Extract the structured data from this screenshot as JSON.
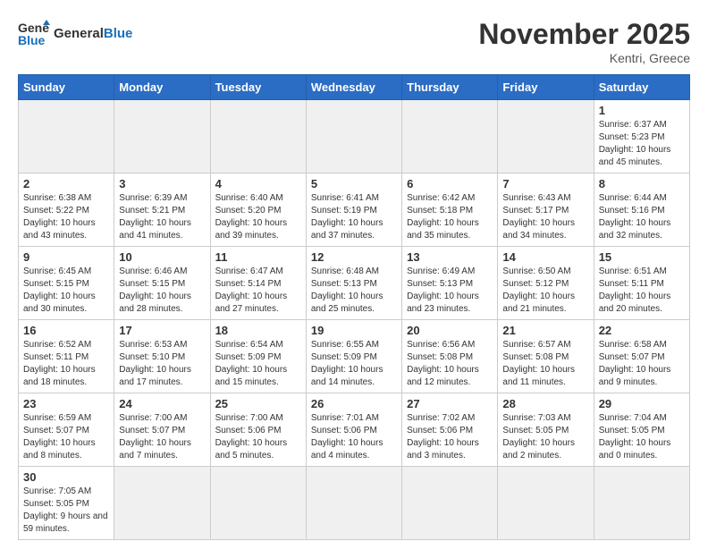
{
  "header": {
    "logo_general": "General",
    "logo_blue": "Blue",
    "month_title": "November 2025",
    "subtitle": "Kentri, Greece"
  },
  "weekdays": [
    "Sunday",
    "Monday",
    "Tuesday",
    "Wednesday",
    "Thursday",
    "Friday",
    "Saturday"
  ],
  "weeks": [
    [
      {
        "day": "",
        "content": ""
      },
      {
        "day": "",
        "content": ""
      },
      {
        "day": "",
        "content": ""
      },
      {
        "day": "",
        "content": ""
      },
      {
        "day": "",
        "content": ""
      },
      {
        "day": "",
        "content": ""
      },
      {
        "day": "1",
        "content": "Sunrise: 6:37 AM\nSunset: 5:23 PM\nDaylight: 10 hours and 45 minutes."
      }
    ],
    [
      {
        "day": "2",
        "content": "Sunrise: 6:38 AM\nSunset: 5:22 PM\nDaylight: 10 hours and 43 minutes."
      },
      {
        "day": "3",
        "content": "Sunrise: 6:39 AM\nSunset: 5:21 PM\nDaylight: 10 hours and 41 minutes."
      },
      {
        "day": "4",
        "content": "Sunrise: 6:40 AM\nSunset: 5:20 PM\nDaylight: 10 hours and 39 minutes."
      },
      {
        "day": "5",
        "content": "Sunrise: 6:41 AM\nSunset: 5:19 PM\nDaylight: 10 hours and 37 minutes."
      },
      {
        "day": "6",
        "content": "Sunrise: 6:42 AM\nSunset: 5:18 PM\nDaylight: 10 hours and 35 minutes."
      },
      {
        "day": "7",
        "content": "Sunrise: 6:43 AM\nSunset: 5:17 PM\nDaylight: 10 hours and 34 minutes."
      },
      {
        "day": "8",
        "content": "Sunrise: 6:44 AM\nSunset: 5:16 PM\nDaylight: 10 hours and 32 minutes."
      }
    ],
    [
      {
        "day": "9",
        "content": "Sunrise: 6:45 AM\nSunset: 5:15 PM\nDaylight: 10 hours and 30 minutes."
      },
      {
        "day": "10",
        "content": "Sunrise: 6:46 AM\nSunset: 5:15 PM\nDaylight: 10 hours and 28 minutes."
      },
      {
        "day": "11",
        "content": "Sunrise: 6:47 AM\nSunset: 5:14 PM\nDaylight: 10 hours and 27 minutes."
      },
      {
        "day": "12",
        "content": "Sunrise: 6:48 AM\nSunset: 5:13 PM\nDaylight: 10 hours and 25 minutes."
      },
      {
        "day": "13",
        "content": "Sunrise: 6:49 AM\nSunset: 5:13 PM\nDaylight: 10 hours and 23 minutes."
      },
      {
        "day": "14",
        "content": "Sunrise: 6:50 AM\nSunset: 5:12 PM\nDaylight: 10 hours and 21 minutes."
      },
      {
        "day": "15",
        "content": "Sunrise: 6:51 AM\nSunset: 5:11 PM\nDaylight: 10 hours and 20 minutes."
      }
    ],
    [
      {
        "day": "16",
        "content": "Sunrise: 6:52 AM\nSunset: 5:11 PM\nDaylight: 10 hours and 18 minutes."
      },
      {
        "day": "17",
        "content": "Sunrise: 6:53 AM\nSunset: 5:10 PM\nDaylight: 10 hours and 17 minutes."
      },
      {
        "day": "18",
        "content": "Sunrise: 6:54 AM\nSunset: 5:09 PM\nDaylight: 10 hours and 15 minutes."
      },
      {
        "day": "19",
        "content": "Sunrise: 6:55 AM\nSunset: 5:09 PM\nDaylight: 10 hours and 14 minutes."
      },
      {
        "day": "20",
        "content": "Sunrise: 6:56 AM\nSunset: 5:08 PM\nDaylight: 10 hours and 12 minutes."
      },
      {
        "day": "21",
        "content": "Sunrise: 6:57 AM\nSunset: 5:08 PM\nDaylight: 10 hours and 11 minutes."
      },
      {
        "day": "22",
        "content": "Sunrise: 6:58 AM\nSunset: 5:07 PM\nDaylight: 10 hours and 9 minutes."
      }
    ],
    [
      {
        "day": "23",
        "content": "Sunrise: 6:59 AM\nSunset: 5:07 PM\nDaylight: 10 hours and 8 minutes."
      },
      {
        "day": "24",
        "content": "Sunrise: 7:00 AM\nSunset: 5:07 PM\nDaylight: 10 hours and 7 minutes."
      },
      {
        "day": "25",
        "content": "Sunrise: 7:00 AM\nSunset: 5:06 PM\nDaylight: 10 hours and 5 minutes."
      },
      {
        "day": "26",
        "content": "Sunrise: 7:01 AM\nSunset: 5:06 PM\nDaylight: 10 hours and 4 minutes."
      },
      {
        "day": "27",
        "content": "Sunrise: 7:02 AM\nSunset: 5:06 PM\nDaylight: 10 hours and 3 minutes."
      },
      {
        "day": "28",
        "content": "Sunrise: 7:03 AM\nSunset: 5:05 PM\nDaylight: 10 hours and 2 minutes."
      },
      {
        "day": "29",
        "content": "Sunrise: 7:04 AM\nSunset: 5:05 PM\nDaylight: 10 hours and 0 minutes."
      }
    ],
    [
      {
        "day": "30",
        "content": "Sunrise: 7:05 AM\nSunset: 5:05 PM\nDaylight: 9 hours and 59 minutes."
      },
      {
        "day": "",
        "content": ""
      },
      {
        "day": "",
        "content": ""
      },
      {
        "day": "",
        "content": ""
      },
      {
        "day": "",
        "content": ""
      },
      {
        "day": "",
        "content": ""
      },
      {
        "day": "",
        "content": ""
      }
    ]
  ]
}
